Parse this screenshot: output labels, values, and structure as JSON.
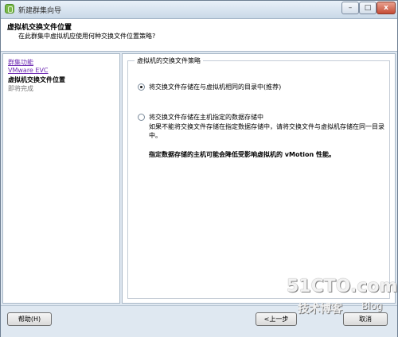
{
  "window": {
    "title": "新建群集向导"
  },
  "header": {
    "title": "虚拟机交换文件位置",
    "subtitle": "在此群集中虚拟机应使用何种交换文件位置策略?"
  },
  "nav": {
    "items": [
      {
        "label": "群集功能",
        "state": "link"
      },
      {
        "label": "VMware EVC",
        "state": "link"
      },
      {
        "label": "虚拟机交换文件位置",
        "state": "current"
      },
      {
        "label": "即将完成",
        "state": "pending"
      }
    ]
  },
  "content": {
    "group_label": "虚拟机的交换文件策略",
    "option1": {
      "label": "将交换文件存储在与虚拟机相同的目录中(推荐)",
      "selected": true
    },
    "option2": {
      "label": "将交换文件存储在主机指定的数据存储中",
      "desc": "如果不能将交换文件存储在指定数据存储中，请将交换文件与虚拟机存储在同一目录中。",
      "selected": false
    },
    "warning": "指定数据存储的主机可能会降低受影响虚拟机的 vMotion 性能。"
  },
  "footer": {
    "help": "帮助(H)",
    "back": "<上一步",
    "cancel": "取消"
  },
  "watermark": {
    "logo": "51CTO.com",
    "sub": "技术博客",
    "blog": "Blog"
  },
  "controls": {
    "minimize": "–",
    "maximize": "□",
    "close": "x"
  }
}
